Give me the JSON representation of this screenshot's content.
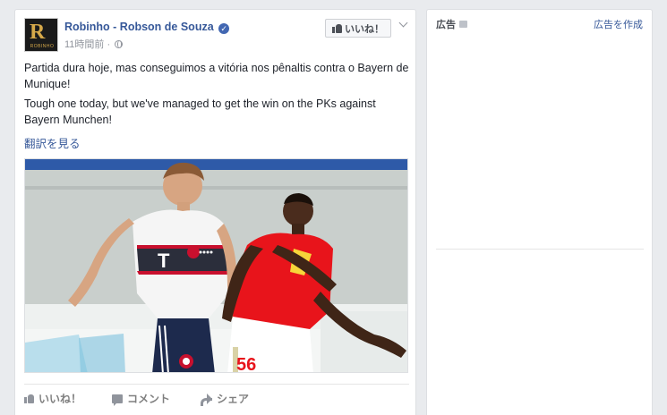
{
  "post": {
    "avatar_monogram": "R",
    "avatar_subtext": "ROBINHO",
    "author": "Robinho - Robson de Souza",
    "verified_mark": "✓",
    "time": "11時間前",
    "separator": " · ",
    "like_page_label": "いいね！",
    "text_pt": "Partida dura hoje, mas conseguimos a vitória nos pênaltis contra o Bayern de Munique!",
    "text_en": "Tough one today, but we've managed to get the win on the PKs against Bayern Munchen!",
    "translate_label": "翻訳を見る",
    "photo": {
      "sponsor_logo": "T",
      "jersey_number": "56"
    },
    "actions": {
      "like": "いいね！",
      "comment": "コメント",
      "share": "シェア"
    }
  },
  "ads": {
    "header": "広告",
    "create_label": "広告を作成"
  },
  "colors": {
    "link_blue": "#365899",
    "bayern_red": "#c8102e",
    "guangzhou_red": "#e8141b",
    "page_bg": "#e9ebee"
  },
  "icons": [
    "thumbs-up-icon",
    "verified-badge-icon",
    "globe-icon",
    "chevron-down-icon",
    "comment-icon",
    "share-icon",
    "ad-info-icon"
  ]
}
